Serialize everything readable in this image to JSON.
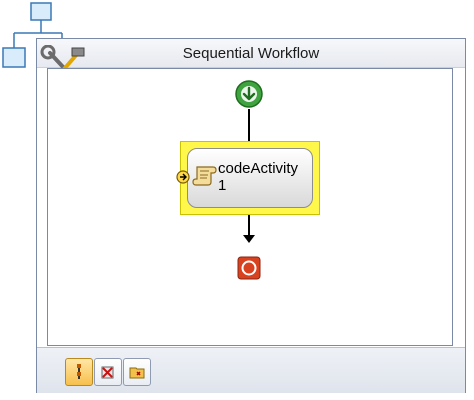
{
  "workflow": {
    "title": "Sequential Workflow"
  },
  "activities": [
    {
      "name": "codeActivity\n1",
      "icon": "script-scroll-icon",
      "selected": true
    }
  ],
  "view_tabs": [
    {
      "icon": "sequence-view-icon",
      "active": true
    },
    {
      "icon": "cancel-handler-view-icon",
      "active": false
    },
    {
      "icon": "fault-handlers-view-icon",
      "active": false
    }
  ],
  "colors": {
    "selection_highlight": "#fff84a",
    "start_node": "#3fa33f",
    "end_node": "#d9421f",
    "frame_border": "#7a8aa6"
  }
}
